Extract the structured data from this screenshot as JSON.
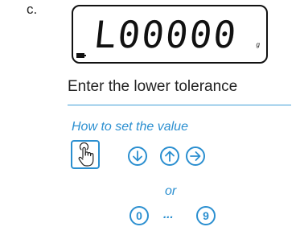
{
  "step": {
    "label": "c."
  },
  "display": {
    "reading": "L00000",
    "unit": "g",
    "battery_icon": "battery-icon"
  },
  "instruction": {
    "text": "Enter the lower tolerance"
  },
  "howto": {
    "title": "How to set the value",
    "or_text": "or",
    "ellipsis": "...",
    "digit_first": "0",
    "digit_last": "9"
  },
  "icons": {
    "press": "hand-press-icon",
    "down": "arrow-down-icon",
    "up": "arrow-up-icon",
    "right": "arrow-right-icon"
  },
  "colors": {
    "accent": "#2b8fd0",
    "text": "#222222",
    "display_border": "#111111"
  }
}
